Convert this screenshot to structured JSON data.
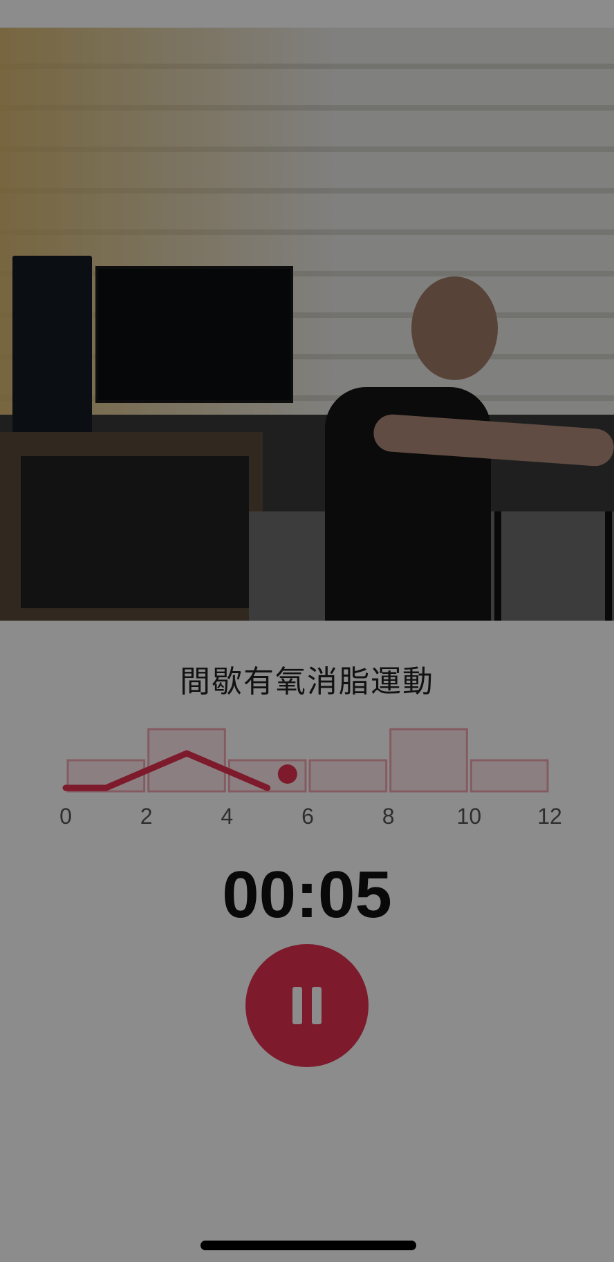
{
  "workout": {
    "title": "間歇有氧消脂運動",
    "timer": "00:05"
  },
  "intensity_chart": {
    "x_ticks": [
      "0",
      "2",
      "4",
      "6",
      "8",
      "10",
      "12"
    ],
    "blocks": [
      {
        "start": 0,
        "end": 2,
        "level": "low"
      },
      {
        "start": 2,
        "end": 4,
        "level": "high"
      },
      {
        "start": 4,
        "end": 6,
        "level": "low"
      },
      {
        "start": 6,
        "end": 8,
        "level": "low"
      },
      {
        "start": 8,
        "end": 10,
        "level": "high"
      },
      {
        "start": 10,
        "end": 12,
        "level": "low"
      }
    ],
    "progress_minutes": 5.5
  },
  "controls": {
    "pause_icon": "pause-icon"
  },
  "colors": {
    "accent": "#e3304f",
    "block_border": "#f2a7b3",
    "block_fill": "#fde8ec"
  }
}
